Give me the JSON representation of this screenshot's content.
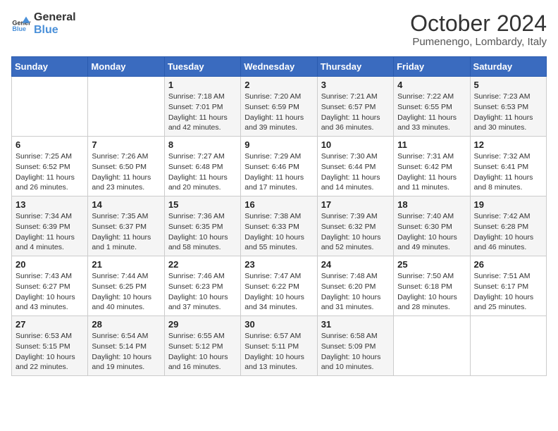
{
  "header": {
    "logo_general": "General",
    "logo_blue": "Blue",
    "month_title": "October 2024",
    "location": "Pumenengo, Lombardy, Italy"
  },
  "days_of_week": [
    "Sunday",
    "Monday",
    "Tuesday",
    "Wednesday",
    "Thursday",
    "Friday",
    "Saturday"
  ],
  "weeks": [
    [
      {
        "day": "",
        "sunrise": "",
        "sunset": "",
        "daylight": ""
      },
      {
        "day": "",
        "sunrise": "",
        "sunset": "",
        "daylight": ""
      },
      {
        "day": "1",
        "sunrise": "Sunrise: 7:18 AM",
        "sunset": "Sunset: 7:01 PM",
        "daylight": "Daylight: 11 hours and 42 minutes."
      },
      {
        "day": "2",
        "sunrise": "Sunrise: 7:20 AM",
        "sunset": "Sunset: 6:59 PM",
        "daylight": "Daylight: 11 hours and 39 minutes."
      },
      {
        "day": "3",
        "sunrise": "Sunrise: 7:21 AM",
        "sunset": "Sunset: 6:57 PM",
        "daylight": "Daylight: 11 hours and 36 minutes."
      },
      {
        "day": "4",
        "sunrise": "Sunrise: 7:22 AM",
        "sunset": "Sunset: 6:55 PM",
        "daylight": "Daylight: 11 hours and 33 minutes."
      },
      {
        "day": "5",
        "sunrise": "Sunrise: 7:23 AM",
        "sunset": "Sunset: 6:53 PM",
        "daylight": "Daylight: 11 hours and 30 minutes."
      }
    ],
    [
      {
        "day": "6",
        "sunrise": "Sunrise: 7:25 AM",
        "sunset": "Sunset: 6:52 PM",
        "daylight": "Daylight: 11 hours and 26 minutes."
      },
      {
        "day": "7",
        "sunrise": "Sunrise: 7:26 AM",
        "sunset": "Sunset: 6:50 PM",
        "daylight": "Daylight: 11 hours and 23 minutes."
      },
      {
        "day": "8",
        "sunrise": "Sunrise: 7:27 AM",
        "sunset": "Sunset: 6:48 PM",
        "daylight": "Daylight: 11 hours and 20 minutes."
      },
      {
        "day": "9",
        "sunrise": "Sunrise: 7:29 AM",
        "sunset": "Sunset: 6:46 PM",
        "daylight": "Daylight: 11 hours and 17 minutes."
      },
      {
        "day": "10",
        "sunrise": "Sunrise: 7:30 AM",
        "sunset": "Sunset: 6:44 PM",
        "daylight": "Daylight: 11 hours and 14 minutes."
      },
      {
        "day": "11",
        "sunrise": "Sunrise: 7:31 AM",
        "sunset": "Sunset: 6:42 PM",
        "daylight": "Daylight: 11 hours and 11 minutes."
      },
      {
        "day": "12",
        "sunrise": "Sunrise: 7:32 AM",
        "sunset": "Sunset: 6:41 PM",
        "daylight": "Daylight: 11 hours and 8 minutes."
      }
    ],
    [
      {
        "day": "13",
        "sunrise": "Sunrise: 7:34 AM",
        "sunset": "Sunset: 6:39 PM",
        "daylight": "Daylight: 11 hours and 4 minutes."
      },
      {
        "day": "14",
        "sunrise": "Sunrise: 7:35 AM",
        "sunset": "Sunset: 6:37 PM",
        "daylight": "Daylight: 11 hours and 1 minute."
      },
      {
        "day": "15",
        "sunrise": "Sunrise: 7:36 AM",
        "sunset": "Sunset: 6:35 PM",
        "daylight": "Daylight: 10 hours and 58 minutes."
      },
      {
        "day": "16",
        "sunrise": "Sunrise: 7:38 AM",
        "sunset": "Sunset: 6:33 PM",
        "daylight": "Daylight: 10 hours and 55 minutes."
      },
      {
        "day": "17",
        "sunrise": "Sunrise: 7:39 AM",
        "sunset": "Sunset: 6:32 PM",
        "daylight": "Daylight: 10 hours and 52 minutes."
      },
      {
        "day": "18",
        "sunrise": "Sunrise: 7:40 AM",
        "sunset": "Sunset: 6:30 PM",
        "daylight": "Daylight: 10 hours and 49 minutes."
      },
      {
        "day": "19",
        "sunrise": "Sunrise: 7:42 AM",
        "sunset": "Sunset: 6:28 PM",
        "daylight": "Daylight: 10 hours and 46 minutes."
      }
    ],
    [
      {
        "day": "20",
        "sunrise": "Sunrise: 7:43 AM",
        "sunset": "Sunset: 6:27 PM",
        "daylight": "Daylight: 10 hours and 43 minutes."
      },
      {
        "day": "21",
        "sunrise": "Sunrise: 7:44 AM",
        "sunset": "Sunset: 6:25 PM",
        "daylight": "Daylight: 10 hours and 40 minutes."
      },
      {
        "day": "22",
        "sunrise": "Sunrise: 7:46 AM",
        "sunset": "Sunset: 6:23 PM",
        "daylight": "Daylight: 10 hours and 37 minutes."
      },
      {
        "day": "23",
        "sunrise": "Sunrise: 7:47 AM",
        "sunset": "Sunset: 6:22 PM",
        "daylight": "Daylight: 10 hours and 34 minutes."
      },
      {
        "day": "24",
        "sunrise": "Sunrise: 7:48 AM",
        "sunset": "Sunset: 6:20 PM",
        "daylight": "Daylight: 10 hours and 31 minutes."
      },
      {
        "day": "25",
        "sunrise": "Sunrise: 7:50 AM",
        "sunset": "Sunset: 6:18 PM",
        "daylight": "Daylight: 10 hours and 28 minutes."
      },
      {
        "day": "26",
        "sunrise": "Sunrise: 7:51 AM",
        "sunset": "Sunset: 6:17 PM",
        "daylight": "Daylight: 10 hours and 25 minutes."
      }
    ],
    [
      {
        "day": "27",
        "sunrise": "Sunrise: 6:53 AM",
        "sunset": "Sunset: 5:15 PM",
        "daylight": "Daylight: 10 hours and 22 minutes."
      },
      {
        "day": "28",
        "sunrise": "Sunrise: 6:54 AM",
        "sunset": "Sunset: 5:14 PM",
        "daylight": "Daylight: 10 hours and 19 minutes."
      },
      {
        "day": "29",
        "sunrise": "Sunrise: 6:55 AM",
        "sunset": "Sunset: 5:12 PM",
        "daylight": "Daylight: 10 hours and 16 minutes."
      },
      {
        "day": "30",
        "sunrise": "Sunrise: 6:57 AM",
        "sunset": "Sunset: 5:11 PM",
        "daylight": "Daylight: 10 hours and 13 minutes."
      },
      {
        "day": "31",
        "sunrise": "Sunrise: 6:58 AM",
        "sunset": "Sunset: 5:09 PM",
        "daylight": "Daylight: 10 hours and 10 minutes."
      },
      {
        "day": "",
        "sunrise": "",
        "sunset": "",
        "daylight": ""
      },
      {
        "day": "",
        "sunrise": "",
        "sunset": "",
        "daylight": ""
      }
    ]
  ]
}
